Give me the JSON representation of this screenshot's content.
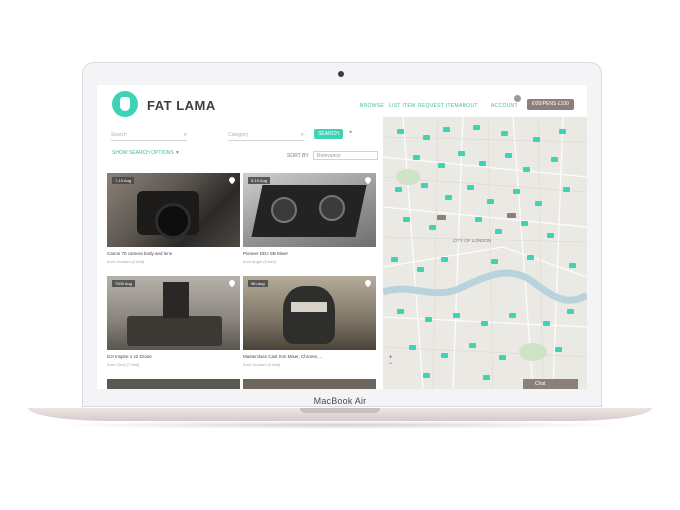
{
  "device": {
    "label": "MacBook Air"
  },
  "header": {
    "brand": "FAT LAMA",
    "nav": [
      "BROWSE",
      "LIST ITEM",
      "REQUEST ITEM",
      "ABOUT",
      "ACCOUNT"
    ],
    "cta_label": "Ð20/PENS £100"
  },
  "search": {
    "search_placeholder": "Search",
    "category_placeholder": "Category",
    "search_button": "SEARCH",
    "options_link": "SHOW SEARCH OPTIONS ▼",
    "sort_label": "SORT BY",
    "sort_value": "Relevance"
  },
  "listings": [
    {
      "date": "7-10 Aug",
      "title": "Canon 70 camera body and lens",
      "owner": "from Graham (3 bed)"
    },
    {
      "date": "9-10 Aug",
      "title": "Pioneer DDJ SB Mixer",
      "owner": "from Angie (5 bed)"
    },
    {
      "date": "7000 Aug",
      "title": "DJI Inspire 1 v2 Drone",
      "owner": "from Chris (7 bed)"
    },
    {
      "date": "9th Aug",
      "title": "Masterclass Cast Iron Mixer, Chrome,...",
      "owner": "from Graham (3 bed)"
    }
  ],
  "map": {
    "city_label": "CITY OF LONDON",
    "chat_label": "Chat",
    "zoom_in": "+",
    "zoom_out": "−"
  },
  "colors": {
    "accent": "#3fd3b6",
    "muted_button": "#8c7f7a"
  }
}
